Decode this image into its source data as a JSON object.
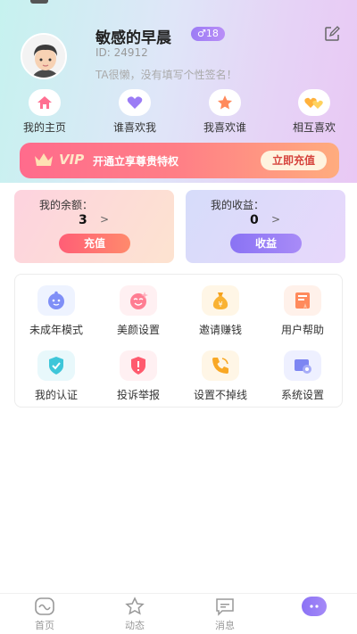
{
  "profile": {
    "nickname": "敏感的早晨",
    "gender_badge": "♂18",
    "user_id": "ID: 24912",
    "signature": "TA很懒，没有填写个性签名！"
  },
  "quick_links": [
    {
      "label": "我的主页",
      "icon": "home-icon"
    },
    {
      "label": "谁喜欢我",
      "icon": "heart-icon"
    },
    {
      "label": "我喜欢谁",
      "icon": "star-icon"
    },
    {
      "label": "相互喜欢",
      "icon": "mutual-hearts-icon"
    }
  ],
  "vip": {
    "badge": "VIP",
    "description": "开通立享尊贵特权",
    "button": "立即充值"
  },
  "balance": {
    "title": "我的余额：",
    "value": "3",
    "arrow": ">",
    "button": "充值"
  },
  "earnings": {
    "title": "我的收益：",
    "value": "0",
    "arrow": ">",
    "button": "收益"
  },
  "tools": [
    {
      "label": "未成年模式",
      "icon": "child-face-icon"
    },
    {
      "label": "美颜设置",
      "icon": "beauty-face-icon"
    },
    {
      "label": "邀请赚钱",
      "icon": "money-bag-icon"
    },
    {
      "label": "用户帮助",
      "icon": "help-book-icon"
    },
    {
      "label": "我的认证",
      "icon": "verified-badge-icon"
    },
    {
      "label": "投诉举报",
      "icon": "report-shield-icon"
    },
    {
      "label": "设置不掉线",
      "icon": "phone-icon"
    },
    {
      "label": "系统设置",
      "icon": "settings-icon"
    }
  ],
  "bottom_nav": [
    {
      "label": "首页",
      "icon": "home-wave-icon"
    },
    {
      "label": "动态",
      "icon": "star-outline-icon"
    },
    {
      "label": "消息",
      "icon": "message-icon"
    },
    {
      "label": "",
      "icon": "profile-active-icon"
    }
  ],
  "colors": {
    "accent_purple": "#8b72f5",
    "vip_red": "#ff6b8c",
    "recharge_red": "#ff5e76"
  }
}
